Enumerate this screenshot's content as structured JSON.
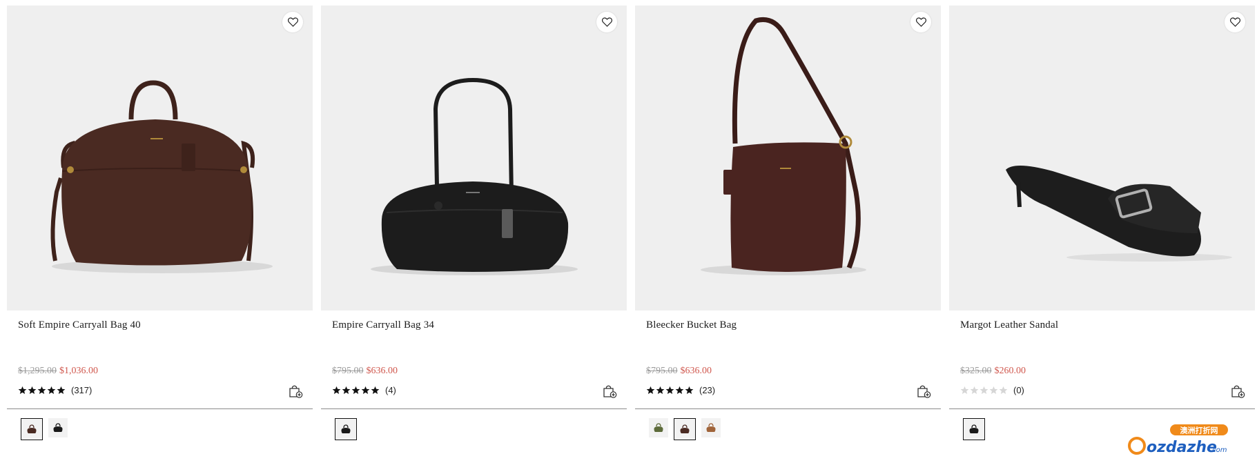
{
  "products": [
    {
      "name": "Soft Empire Carryall Bag 40",
      "original_price": "$1,295.00",
      "sale_price": "$1,036.00",
      "rating": 5,
      "review_count": "(317)",
      "image": "brown-carryall-bag",
      "swatch_colors": [
        "#4a2a22",
        "#1a1a1a"
      ],
      "selected_swatch": 0
    },
    {
      "name": "Empire Carryall Bag 34",
      "original_price": "$795.00",
      "sale_price": "$636.00",
      "rating": 5,
      "review_count": "(4)",
      "image": "black-carryall-bag",
      "swatch_colors": [
        "#1a1a1a"
      ],
      "selected_swatch": 0
    },
    {
      "name": "Bleecker Bucket Bag",
      "original_price": "$795.00",
      "sale_price": "$636.00",
      "rating": 5,
      "review_count": "(23)",
      "image": "brown-bucket-bag",
      "swatch_colors": [
        "#5d6b3a",
        "#4a2a22",
        "#a0643a"
      ],
      "selected_swatch": 1
    },
    {
      "name": "Margot Leather Sandal",
      "original_price": "$325.00",
      "sale_price": "$260.00",
      "rating": 0,
      "review_count": "(0)",
      "image": "black-kitten-heel-sandal",
      "swatch_colors": [
        "#1a1a1a"
      ],
      "selected_swatch": 0
    }
  ],
  "watermark": {
    "text": "ozdazhe",
    "suffix": ".com",
    "badge": "澳洲打折网"
  },
  "colors": {
    "sale": "#d0584e",
    "strike": "#9a9a9a",
    "star_filled": "#111111",
    "star_empty": "#d6d6d6",
    "image_bg": "#efefef"
  }
}
